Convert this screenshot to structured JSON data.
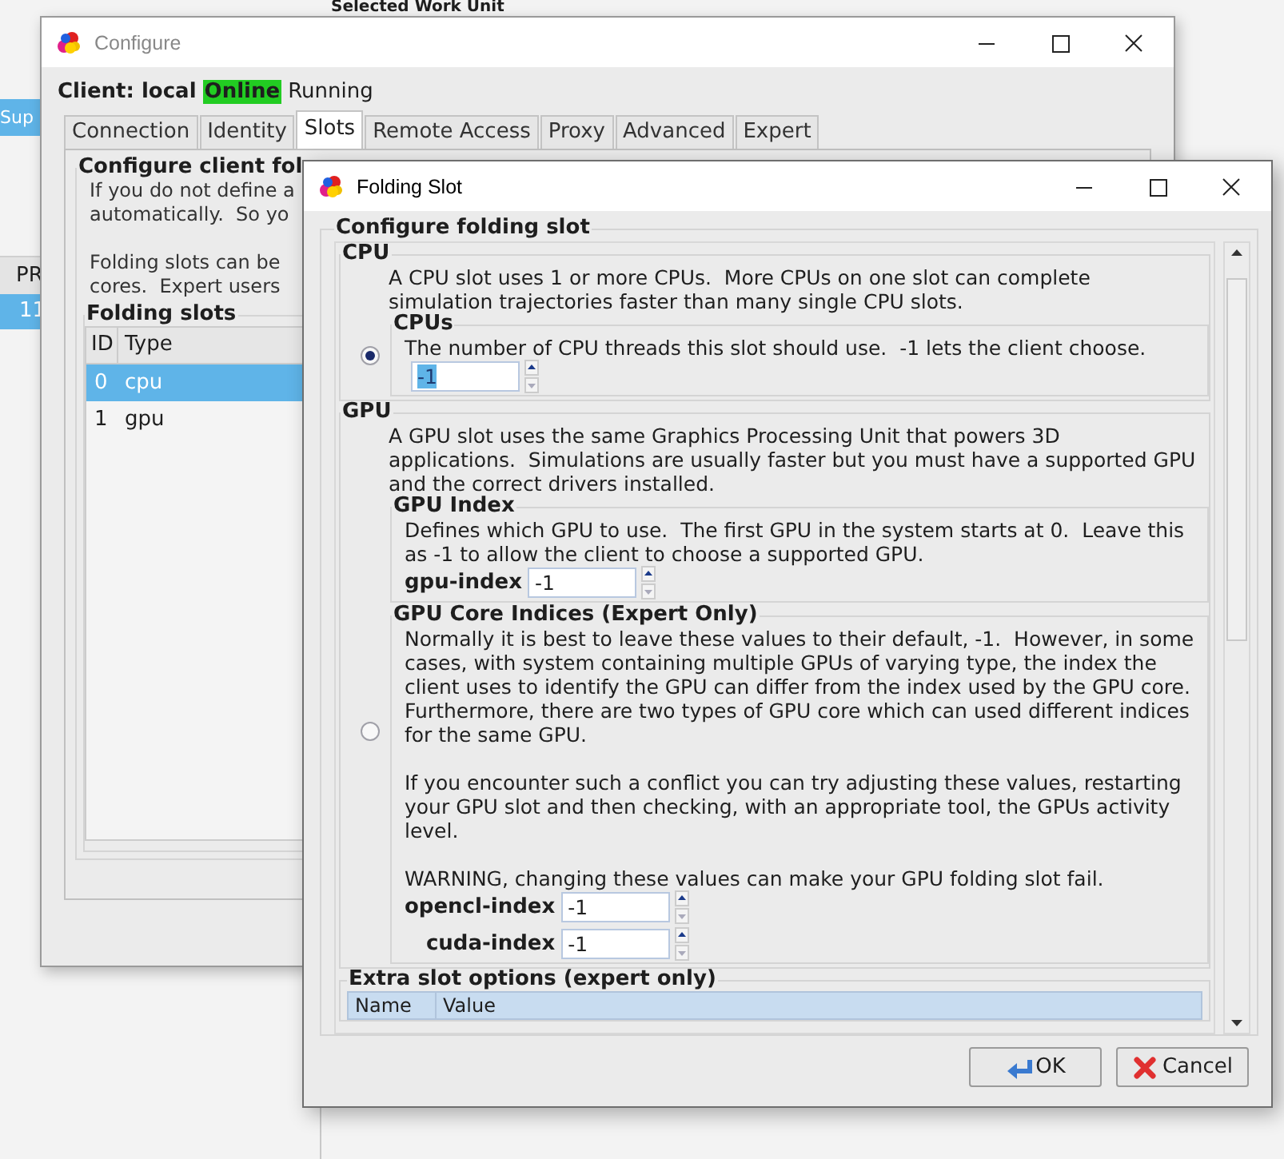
{
  "background_app": {
    "heading": "Selected Work Unit",
    "sidebar_item": {
      "label": "Sup",
      "selected": true
    },
    "table": {
      "columns": [
        "PR"
      ],
      "rows": [
        {
          "cells": [
            "11"
          ],
          "selected": true
        }
      ]
    }
  },
  "configure_window": {
    "title": "Configure",
    "client": {
      "label": "Client: local",
      "status": "Online",
      "online": true,
      "state": "Running"
    },
    "tabs": [
      {
        "label": "Connection",
        "selected": false
      },
      {
        "label": "Identity",
        "selected": false
      },
      {
        "label": "Slots",
        "selected": true
      },
      {
        "label": "Remote Access",
        "selected": false
      },
      {
        "label": "Proxy",
        "selected": false
      },
      {
        "label": "Advanced",
        "selected": false
      },
      {
        "label": "Expert",
        "selected": false
      }
    ],
    "slots_tab": {
      "title": "Configure client fol",
      "paragraphs": [
        "If you do not define a\nautomatically.  So yo",
        "Folding slots can be\ncores.  Expert users"
      ],
      "folding_slots": {
        "title": "Folding slots",
        "columns": [
          "ID",
          "Type"
        ],
        "rows": [
          {
            "cells": [
              "0",
              "cpu"
            ],
            "selected": true
          },
          {
            "cells": [
              "1",
              "gpu"
            ],
            "selected": false
          }
        ]
      }
    }
  },
  "slot_dialog": {
    "title": "Folding Slot",
    "group_title": "Configure folding slot",
    "sections": [
      {
        "title": "CPU",
        "selected": true,
        "description": "A CPU slot uses 1 or more CPUs.  More CPUs on one slot can complete\nsimulation trajectories faster than many single CPU slots.",
        "subgroups": [
          {
            "title": "CPUs",
            "description": "The number of CPU threads this slot should use.  -1 lets the client choose.",
            "fields": [
              {
                "value": "-1",
                "text_selected": true
              }
            ]
          }
        ]
      },
      {
        "title": "GPU",
        "selected": false,
        "description": "A GPU slot uses the same Graphics Processing Unit that powers 3D\napplications.  Simulations are usually faster but you must have a supported GPU\nand the correct drivers installed.",
        "subgroups": [
          {
            "title": "GPU Index",
            "description": "Defines which GPU to use.  The first GPU in the system starts at 0.  Leave this\nas -1 to allow the client to choose a supported GPU.",
            "fields": [
              {
                "label": "gpu-index",
                "value": "-1",
                "text_selected": false
              }
            ]
          },
          {
            "title": "GPU Core Indices (Expert Only)",
            "description": "Normally it is best to leave these values to their default, -1.  However, in some\ncases, with system containing multiple GPUs of varying type, the index the\nclient uses to identify the GPU can differ from the index used by the GPU core.\nFurthermore, there are two types of GPU core which can used different indices\nfor the same GPU.\n\nIf you encounter such a conflict you can try adjusting these values, restarting\nyour GPU slot and then checking, with an appropriate tool, the GPUs activity\nlevel.\n\nWARNING, changing these values can make your GPU folding slot fail.",
            "fields": [
              {
                "label": "opencl-index",
                "value": "-1",
                "text_selected": false
              },
              {
                "label": "cuda-index",
                "value": "-1",
                "text_selected": false
              }
            ]
          }
        ]
      }
    ],
    "extra_options": {
      "title": "Extra slot options (expert only)",
      "columns": [
        "Name",
        "Value"
      ]
    },
    "buttons": [
      {
        "label": "OK",
        "kind": "ok"
      },
      {
        "label": "Cancel",
        "kind": "cancel"
      }
    ]
  }
}
